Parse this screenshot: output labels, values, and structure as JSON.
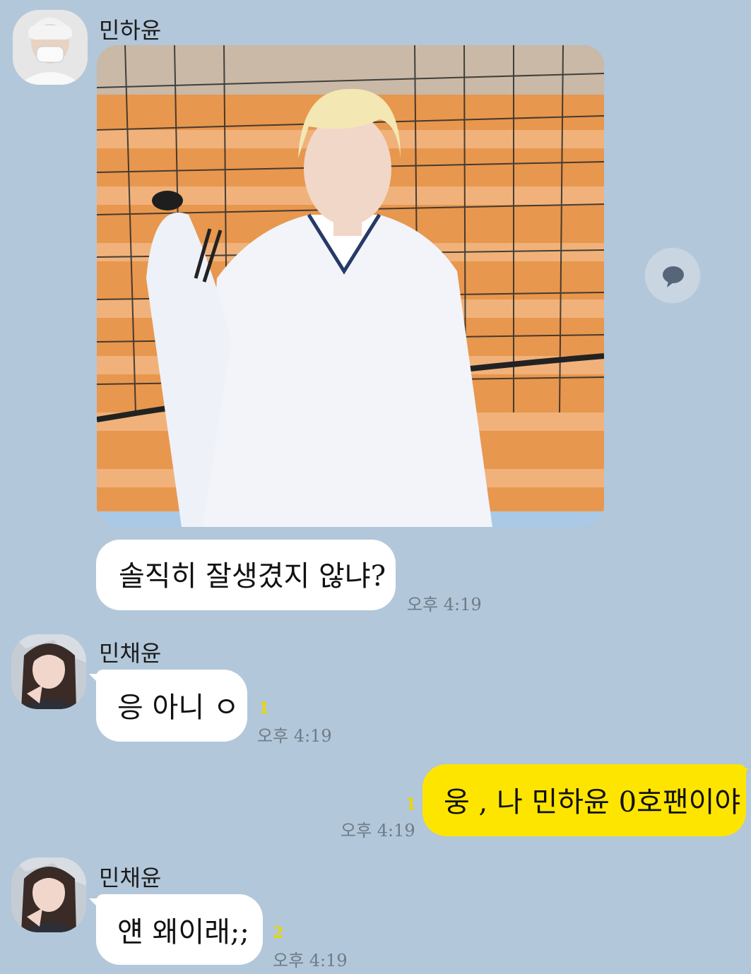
{
  "messages": [
    {
      "sender": "민하윤",
      "type": "image"
    },
    {
      "sender": "민하윤",
      "text": "솔직히 잘생겼지 않냐?",
      "time": "오후 4:19"
    },
    {
      "sender": "민채윤",
      "text": "응 아니 ㅇ",
      "unread": "1",
      "time": "오후 4:19"
    },
    {
      "sender": "me",
      "text": "웅 , 나 민하윤 0호팬이야",
      "unread": "1",
      "time": "오후 4:19"
    },
    {
      "sender": "민채윤",
      "text": "얜 왜이래;;",
      "unread": "2",
      "time": "오후 4:19"
    }
  ],
  "colors": {
    "background": "#b2c7da",
    "my_bubble": "#fee500",
    "other_bubble": "#ffffff",
    "unread": "#e8d800"
  },
  "icons": {
    "share": "speech-bubble-icon"
  }
}
